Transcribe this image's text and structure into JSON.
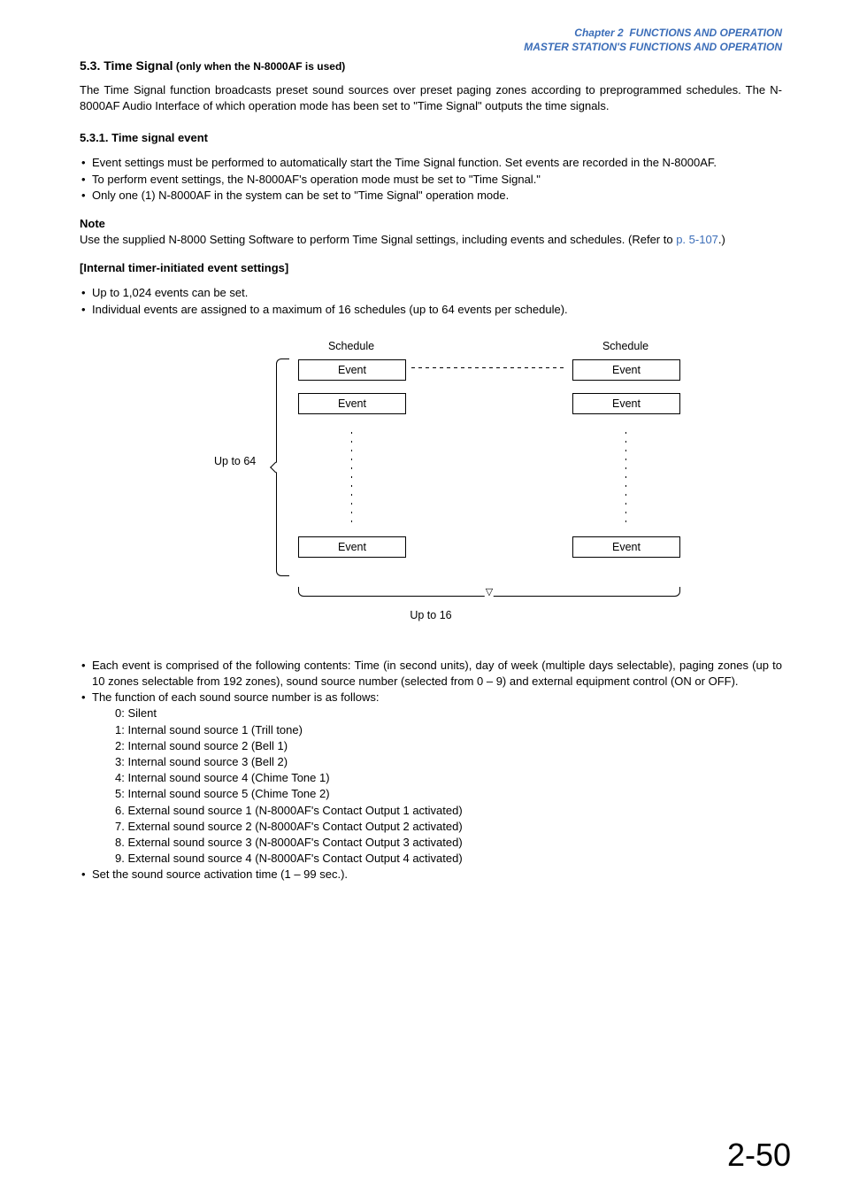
{
  "header": {
    "line1_prefix": "Chapter 2",
    "line1_rest": "FUNCTIONS AND OPERATION",
    "line2": "MASTER STATION'S FUNCTIONS AND OPERATION"
  },
  "section": {
    "num_title": "5.3. Time Signal",
    "qualifier": " (only when the N-8000AF is used)",
    "intro": "The Time Signal function broadcasts preset sound sources over preset paging zones according to preprogrammed schedules. The N-8000AF Audio Interface of which operation mode has been set to \"Time Signal\" outputs the time signals."
  },
  "subsection": {
    "title": "5.3.1. Time signal event",
    "bullets": [
      "Event settings must be performed to automatically start the Time Signal function. Set events are recorded in the N-8000AF.",
      "To perform event settings, the N-8000AF's operation mode must be set to \"Time Signal.\"",
      "Only one (1) N-8000AF in the system can be set to \"Time Signal\" operation mode."
    ],
    "note_label": "Note",
    "note_text_1": "Use the supplied N-8000 Setting Software to perform Time Signal settings, including events and schedules. (Refer to ",
    "note_link": "p. 5-107",
    "note_text_2": ".)",
    "bracket_title": "[Internal timer-initiated event settings]",
    "bullets2": [
      "Up to 1,024 events can be set.",
      "Individual events are assigned to a maximum of 16 schedules (up to 64 events per schedule)."
    ]
  },
  "diagram": {
    "schedule_label": "Schedule",
    "event_label": "Event",
    "up64": "Up to 64",
    "up16": "Up to 16"
  },
  "after_diagram": {
    "bullets": [
      "Each event is comprised of the following contents: Time (in second units), day of week (multiple days selectable), paging zones (up to 10 zones selectable from 192 zones), sound source number (selected from 0 – 9) and external equipment control (ON or OFF).",
      "The function of each sound source number is as follows:"
    ],
    "sound_list": [
      "0: Silent",
      "1: Internal sound source 1 (Trill tone)",
      "2: Internal sound source 2 (Bell 1)",
      "3: Internal sound source 3 (Bell 2)",
      "4: Internal sound source 4 (Chime Tone 1)",
      "5: Internal sound source 5 (Chime Tone 2)",
      "6. External sound source 1 (N-8000AF's Contact Output 1 activated)",
      "7. External sound source 2 (N-8000AF's Contact Output 2 activated)",
      "8. External sound source 3 (N-8000AF's Contact Output 3 activated)",
      "9. External sound source 4 (N-8000AF's Contact Output 4 activated)"
    ],
    "last_bullet": "Set the sound source activation time (1 – 99 sec.)."
  },
  "page_number": "2-50"
}
